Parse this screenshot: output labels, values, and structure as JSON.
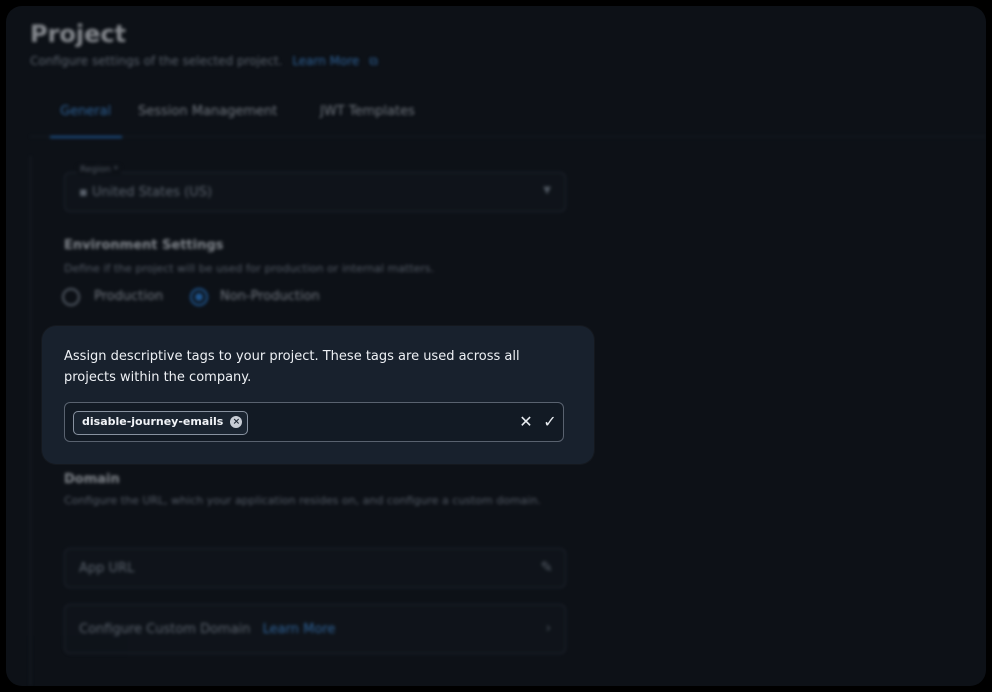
{
  "header": {
    "title": "Project",
    "subtitle": "Configure settings of the selected project.",
    "learn_more": "Learn More"
  },
  "tabs": [
    {
      "label": "General",
      "active": true
    },
    {
      "label": "Session Management",
      "active": false
    },
    {
      "label": "JWT Templates",
      "active": false
    }
  ],
  "region": {
    "label": "Region *",
    "value": "United States (US)"
  },
  "environment": {
    "title": "Environment Settings",
    "description": "Define if the project will be used for production or internal matters.",
    "options": [
      {
        "label": "Production",
        "selected": false
      },
      {
        "label": "Non-Production",
        "selected": true
      }
    ]
  },
  "tags": {
    "description": "Assign descriptive tags to your project. These tags are used across all projects within the company.",
    "chips": [
      "disable-journey-emails"
    ]
  },
  "domain": {
    "title": "Domain",
    "description": "Configure the URL, which your application resides on, and configure a custom domain.",
    "app_url_placeholder": "App URL",
    "custom_domain_label": "Configure Custom Domain",
    "custom_domain_link": "Learn More"
  },
  "colors": {
    "accent": "#2d8cf0",
    "background": "#0d1117",
    "card": "#18212d"
  }
}
